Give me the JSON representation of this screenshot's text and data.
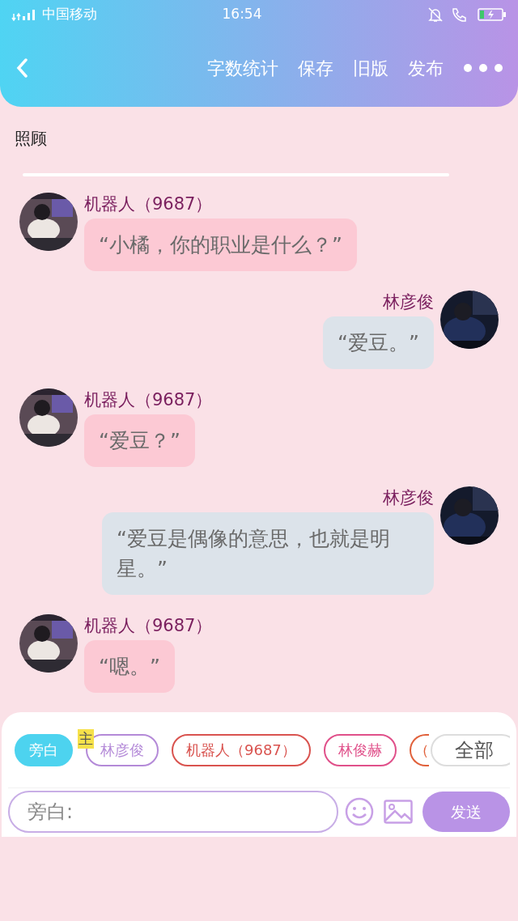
{
  "status_bar": {
    "carrier": "中国移动",
    "time": "16:54"
  },
  "header": {
    "actions": [
      "字数统计",
      "保存",
      "旧版",
      "发布"
    ]
  },
  "title": "照顾",
  "messages": [
    {
      "kind": "incoming",
      "name": "机器人（9687）",
      "text": "“小橘，你的职业是什么？”"
    },
    {
      "kind": "outgoing",
      "name": "林彦俊",
      "text": "“爱豆。”"
    },
    {
      "kind": "incoming",
      "name": "机器人（9687）",
      "text": "“爱豆？”"
    },
    {
      "kind": "outgoing",
      "name": "林彦俊",
      "text": "“爱豆是偶像的意思，也就是明星。”"
    },
    {
      "kind": "incoming",
      "name": "机器人（9687）",
      "text": "“嗯。”"
    }
  ],
  "roles": [
    {
      "label": "旁白",
      "selected": true,
      "color": "#4dd3ef"
    },
    {
      "label": "林彦俊",
      "selected": false,
      "color": "#b48ad8",
      "badge": "主"
    },
    {
      "label": "机器人（9687）",
      "selected": false,
      "color": "#d9534f"
    },
    {
      "label": "林俊赫",
      "selected": false,
      "color": "#e0508a"
    },
    {
      "label": "（",
      "selected": false,
      "color": "#e0603a"
    }
  ],
  "all_button": "全部",
  "input": {
    "placeholder": "旁白:"
  },
  "send_button": "发送"
}
